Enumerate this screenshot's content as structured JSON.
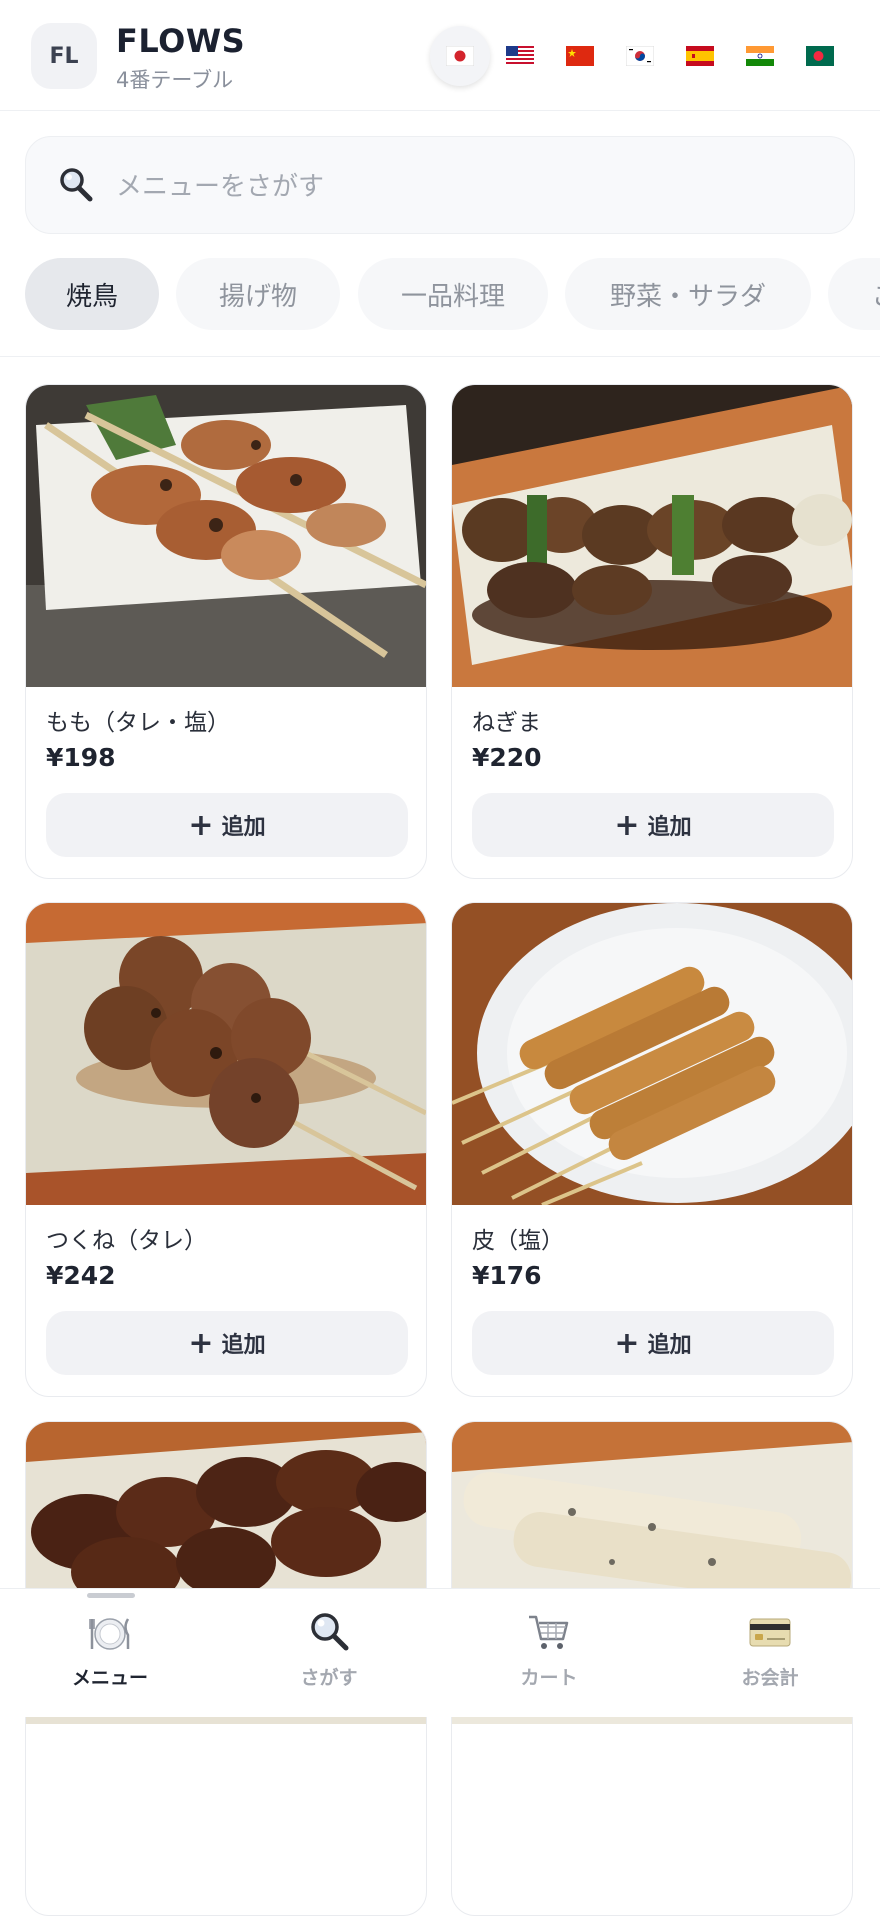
{
  "header": {
    "logo_text": "FL",
    "brand": "FLOWS",
    "table": "4番テーブル",
    "languages": [
      {
        "code": "jp-flag-icon",
        "label": "●",
        "color": "#d3242c",
        "active": true
      },
      {
        "code": "us-flag-icon",
        "label": "US",
        "color": "#1e3a8a",
        "active": false
      },
      {
        "code": "cn-flag-icon",
        "label": "CN",
        "color": "#d3242c",
        "active": false
      },
      {
        "code": "kr-flag-icon",
        "label": "KR",
        "color": "#1f3f8f",
        "active": false
      },
      {
        "code": "es-flag-icon",
        "label": "ES",
        "color": "#c8102e",
        "active": false
      },
      {
        "code": "in-flag-icon",
        "label": "IN",
        "color": "#f28a1c",
        "active": false
      },
      {
        "code": "bd-flag-icon",
        "label": "BD",
        "color": "#0a6b43",
        "active": false
      }
    ]
  },
  "search": {
    "placeholder": "メニューをさがす",
    "value": ""
  },
  "categories": [
    "焼鳥",
    "揚げ物",
    "一品料理",
    "野菜・サラダ",
    "ご"
  ],
  "active_category": "焼鳥",
  "menu": {
    "add_label": "追加",
    "items": [
      {
        "name": "もも（タレ・塩）",
        "price": "¥198"
      },
      {
        "name": "ねぎま",
        "price": "¥220"
      },
      {
        "name": "つくね（タレ）",
        "price": "¥242"
      },
      {
        "name": "皮（塩）",
        "price": "¥176"
      },
      {
        "name": "",
        "price": ""
      },
      {
        "name": "",
        "price": ""
      }
    ]
  },
  "nav": {
    "items": [
      {
        "label": "メニュー",
        "icon": "plate-icon",
        "active": true
      },
      {
        "label": "さがす",
        "icon": "search-icon",
        "active": false
      },
      {
        "label": "カート",
        "icon": "cart-icon",
        "active": false
      },
      {
        "label": "お会計",
        "icon": "credit-card-icon",
        "active": false
      }
    ]
  },
  "colors": {
    "accent_text": "#1f2430",
    "muted_text": "#a3a8b1",
    "chip_active_bg": "#e6e8ec",
    "button_bg": "#f1f2f5"
  }
}
